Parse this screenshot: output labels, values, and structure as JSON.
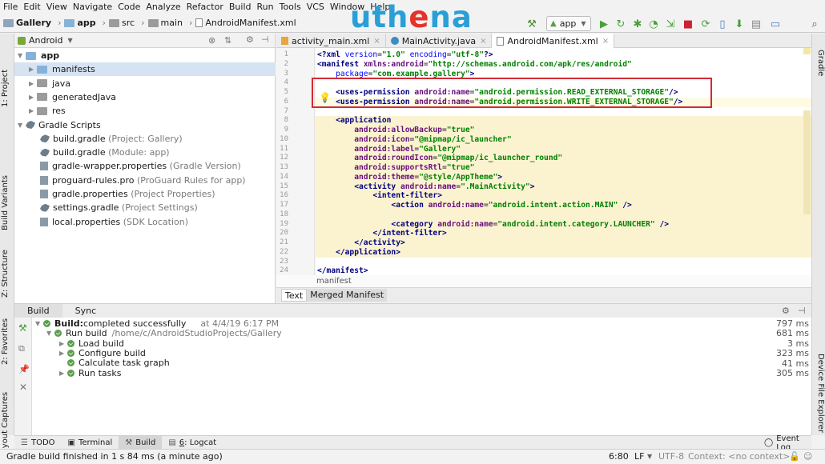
{
  "menu": [
    "File",
    "Edit",
    "View",
    "Navigate",
    "Code",
    "Analyze",
    "Refactor",
    "Build",
    "Run",
    "Tools",
    "VCS",
    "Window",
    "Help"
  ],
  "breadcrumbs": [
    "Gallery",
    "app",
    "src",
    "main",
    "AndroidManifest.xml"
  ],
  "logo": {
    "part1": "uth",
    "part2": "e",
    "part3": "na"
  },
  "run_config": "app",
  "project": {
    "view_label": "Android",
    "tree": [
      {
        "label": "app",
        "suffix": "",
        "level": 0
      },
      {
        "label": "manifests",
        "suffix": "",
        "level": 1
      },
      {
        "label": "java",
        "suffix": "",
        "level": 1
      },
      {
        "label": "generatedJava",
        "suffix": "",
        "level": 1
      },
      {
        "label": "res",
        "suffix": "",
        "level": 1
      },
      {
        "label": "Gradle Scripts",
        "suffix": "",
        "level": 0
      },
      {
        "label": "build.gradle",
        "suffix": "(Project: Gallery)",
        "level": 1
      },
      {
        "label": "build.gradle",
        "suffix": "(Module: app)",
        "level": 1
      },
      {
        "label": "gradle-wrapper.properties",
        "suffix": "(Gradle Version)",
        "level": 1
      },
      {
        "label": "proguard-rules.pro",
        "suffix": "(ProGuard Rules for app)",
        "level": 1
      },
      {
        "label": "gradle.properties",
        "suffix": "(Project Properties)",
        "level": 1
      },
      {
        "label": "settings.gradle",
        "suffix": "(Project Settings)",
        "level": 1
      },
      {
        "label": "local.properties",
        "suffix": "(SDK Location)",
        "level": 1
      }
    ]
  },
  "left_tool_tabs": [
    "1: Project",
    "Build Variants",
    "Z: Structure",
    "2: Favorites",
    "Layout Captures"
  ],
  "right_tool_tabs": [
    "Gradle",
    "Device File Explorer"
  ],
  "editor_tabs": [
    "activity_main.xml",
    "MainActivity.java",
    "AndroidManifest.xml"
  ],
  "code_lines": [
    "<?xml version=\"1.0\" encoding=\"utf-8\"?>",
    "<manifest xmlns:android=\"http://schemas.android.com/apk/res/android\"",
    "    package=\"com.example.gallery\">",
    "",
    "    <uses-permission android:name=\"android.permission.READ_EXTERNAL_STORAGE\"/>",
    "    <uses-permission android:name=\"android.permission.WRITE_EXTERNAL_STORAGE\"/>",
    "",
    "    <application",
    "        android:allowBackup=\"true\"",
    "        android:icon=\"@mipmap/ic_launcher\"",
    "        android:label=\"Gallery\"",
    "        android:roundIcon=\"@mipmap/ic_launcher_round\"",
    "        android:supportsRtl=\"true\"",
    "        android:theme=\"@style/AppTheme\">",
    "        <activity android:name=\".MainActivity\">",
    "            <intent-filter>",
    "                <action android:name=\"android.intent.action.MAIN\" />",
    "",
    "                <category android:name=\"android.intent.category.LAUNCHER\" />",
    "            </intent-filter>",
    "        </activity>",
    "    </application>",
    "",
    "</manifest>"
  ],
  "editor_breadcrumb": "manifest",
  "editor_bottom_tabs": [
    "Text",
    "Merged Manifest"
  ],
  "build_tabs": [
    "Build",
    "Sync"
  ],
  "build_tree": [
    {
      "label": "Build:",
      "rest": " completed successfully",
      "extra": "at 4/4/19 6:17 PM",
      "time": "797 ms",
      "level": 0
    },
    {
      "label": "Run build",
      "rest": "",
      "extra": "/home/c/AndroidStudioProjects/Gallery",
      "time": "681 ms",
      "level": 1
    },
    {
      "label": "Load build",
      "rest": "",
      "extra": "",
      "time": "3 ms",
      "level": 2
    },
    {
      "label": "Configure build",
      "rest": "",
      "extra": "",
      "time": "323 ms",
      "level": 2
    },
    {
      "label": "Calculate task graph",
      "rest": "",
      "extra": "",
      "time": "41 ms",
      "level": 2
    },
    {
      "label": "Run tasks",
      "rest": "",
      "extra": "",
      "time": "305 ms",
      "level": 2
    }
  ],
  "bottom_tabs": [
    {
      "key": "",
      "label": "TODO"
    },
    {
      "key": "",
      "label": "Terminal"
    },
    {
      "key": "",
      "label": "Build"
    },
    {
      "key": "6",
      "label": ": Logcat"
    }
  ],
  "event_log": "Event Log",
  "status": {
    "message": "Gradle build finished in 1 s 84 ms (a minute ago)",
    "position": "6:80",
    "line_sep": "LF",
    "encoding": "UTF-8",
    "context": "Context: <no context>"
  }
}
